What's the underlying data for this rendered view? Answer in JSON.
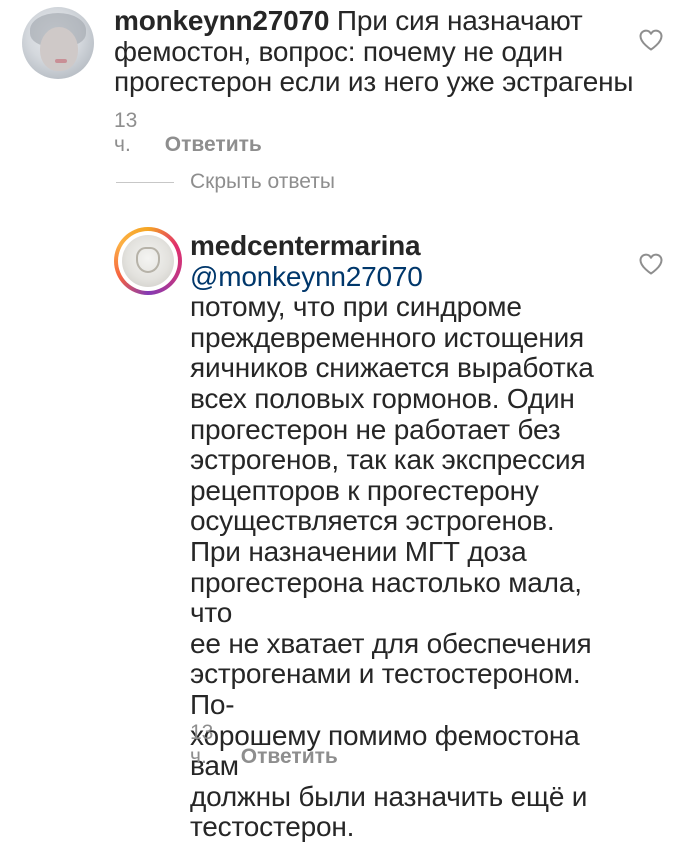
{
  "comments": [
    {
      "username": "monkeynn27070",
      "text_first": "При сия назначают",
      "lines": [
        "фемостон,  вопрос: почему не один",
        "прогестерон если из него уже эстрагены"
      ],
      "time": "13 ч.",
      "reply_label": "Ответить",
      "avatar_icon": "user-avatar"
    }
  ],
  "hide_replies_label": "Скрыть ответы",
  "reply": {
    "username": "medcentermarina",
    "mention": "@monkeynn27070",
    "lines": [
      "потому, что при синдроме",
      "преждевременного истощения",
      "яичников  снижается выработка",
      "всех половых гормонов. Один",
      "прогестерон не работает без",
      "эстрогенов, так как экспрессия",
      "рецепторов к прогестерону",
      "осуществляется эстрогенов.",
      "При назначении МГТ  доза",
      "прогестерона настолько мала, что",
      "ее не хватает для обеспечения",
      "эстрогенами и тестостероном. По-",
      "хорошему помимо фемостона вам",
      "должны были назначить ещё и",
      "тестостерон."
    ],
    "time": "13 ч.",
    "reply_label": "Ответить",
    "avatar_icon": "brand-avatar-with-story-ring"
  },
  "icons": {
    "like": "heart-icon"
  },
  "colors": {
    "text": "#262626",
    "secondary": "#8e8e8e",
    "mention": "#00376b"
  }
}
